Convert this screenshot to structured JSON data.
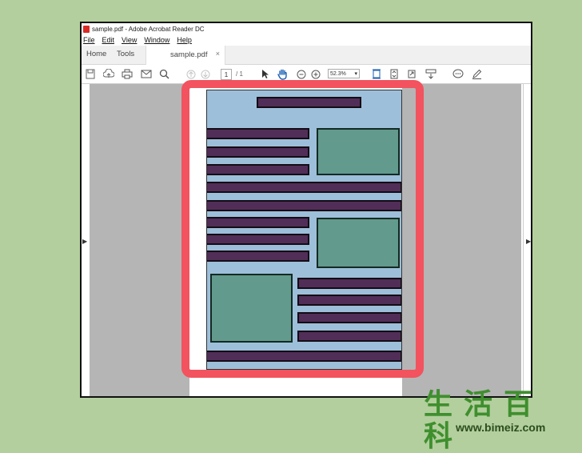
{
  "window": {
    "title": "sample.pdf - Adobe Acrobat Reader DC"
  },
  "menu": {
    "file": "File",
    "edit": "Edit",
    "view": "View",
    "window": "Window",
    "help": "Help"
  },
  "tabs": {
    "home": "Home",
    "tools": "Tools",
    "document": "sample.pdf",
    "close": "×"
  },
  "toolbar": {
    "page_current": "1",
    "page_total": "/ 1",
    "zoom": "52.3%"
  },
  "icons": [
    "save-icon",
    "upload-icon",
    "print-icon",
    "email-icon",
    "search-icon",
    "page-up-icon",
    "page-down-icon",
    "select-cursor-icon",
    "hand-icon",
    "zoom-out-icon",
    "zoom-in-icon",
    "fit-page-icon",
    "scroll-mode-icon",
    "rotate-icon",
    "keyboard-icon",
    "comment-icon",
    "sign-icon"
  ],
  "colors": {
    "highlight": "#f2535e",
    "page_bg": "#9dbfd9",
    "text_bar": "#512e57",
    "image_box": "#629a8e",
    "background": "#b3cf9d"
  },
  "watermark": {
    "chars": "生活百科",
    "url": "www.bimeiz.com"
  }
}
